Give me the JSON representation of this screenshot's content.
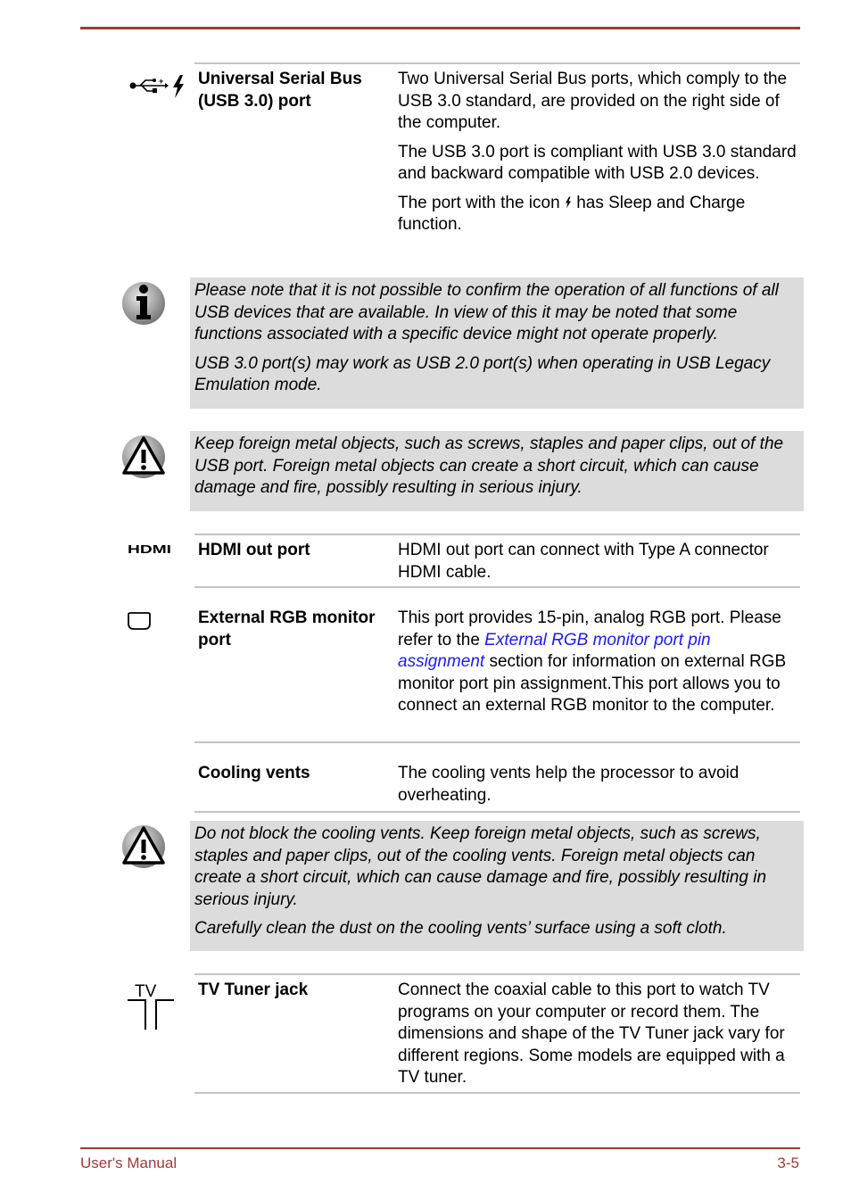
{
  "footer": {
    "left": "User's Manual",
    "right": "3-5"
  },
  "ports": [
    {
      "icon": "usb-sleep-charge-icon",
      "term": "Universal Serial Bus (USB 3.0) port",
      "paragraphs": [
        "Two Universal Serial Bus ports, which comply to the USB 3.0 standard, are provided on the right side of the computer.",
        "The USB 3.0 port is compliant with USB 3.0 standard and backward compatible with USB 2.0 devices."
      ],
      "icon_sentence": {
        "before": "The port with the icon",
        "after": "has Sleep and Charge function."
      }
    },
    {
      "icon": "hdmi-icon",
      "term": "HDMI out port",
      "paragraphs": [
        "HDMI out port can connect with Type A connector HDMI cable."
      ]
    },
    {
      "icon": "rgb-monitor-icon",
      "term": "External RGB monitor port",
      "desc_before": "This port provides 15-pin, analog RGB port. Please refer to the",
      "desc_link": "External RGB monitor port pin assignment",
      "desc_after": "section for information on external RGB monitor port pin assignment.This port allows you to connect an external RGB monitor to the computer."
    },
    {
      "term": "Cooling vents",
      "paragraphs": [
        "The cooling vents help the processor to avoid overheating."
      ]
    },
    {
      "icon": "tv-tuner-icon",
      "term": "TV Tuner jack",
      "paragraphs": [
        "Connect the coaxial cable to this port to watch TV programs on your computer or record them. The dimensions and shape of the TV Tuner jack vary for different regions. Some models are equipped with a TV tuner."
      ]
    }
  ],
  "notes": [
    {
      "type": "info",
      "paragraphs": [
        "Please note that it is not possible to confirm the operation of all functions of all USB devices that are available. In view of this it may be noted that some functions associated with a specific device might not operate properly.",
        "USB 3.0 port(s) may work as USB 2.0 port(s) when operating in USB Legacy Emulation mode."
      ]
    },
    {
      "type": "warning",
      "paragraphs": [
        "Keep foreign metal objects, such as screws, staples and paper clips, out of the USB port. Foreign metal objects can create a short circuit, which can cause damage and fire, possibly resulting in serious injury."
      ]
    },
    {
      "type": "warning",
      "paragraphs": [
        "Do not block the cooling vents. Keep foreign metal objects, such as screws, staples and paper clips, out of the cooling vents. Foreign metal objects can create a short circuit, which can cause damage and fire, possibly resulting in serious injury.",
        "Carefully clean the dust on the cooling vents’ surface using a soft cloth."
      ]
    }
  ],
  "icons": {
    "hdmi_text": "HDMI",
    "tv_text": "TV"
  }
}
